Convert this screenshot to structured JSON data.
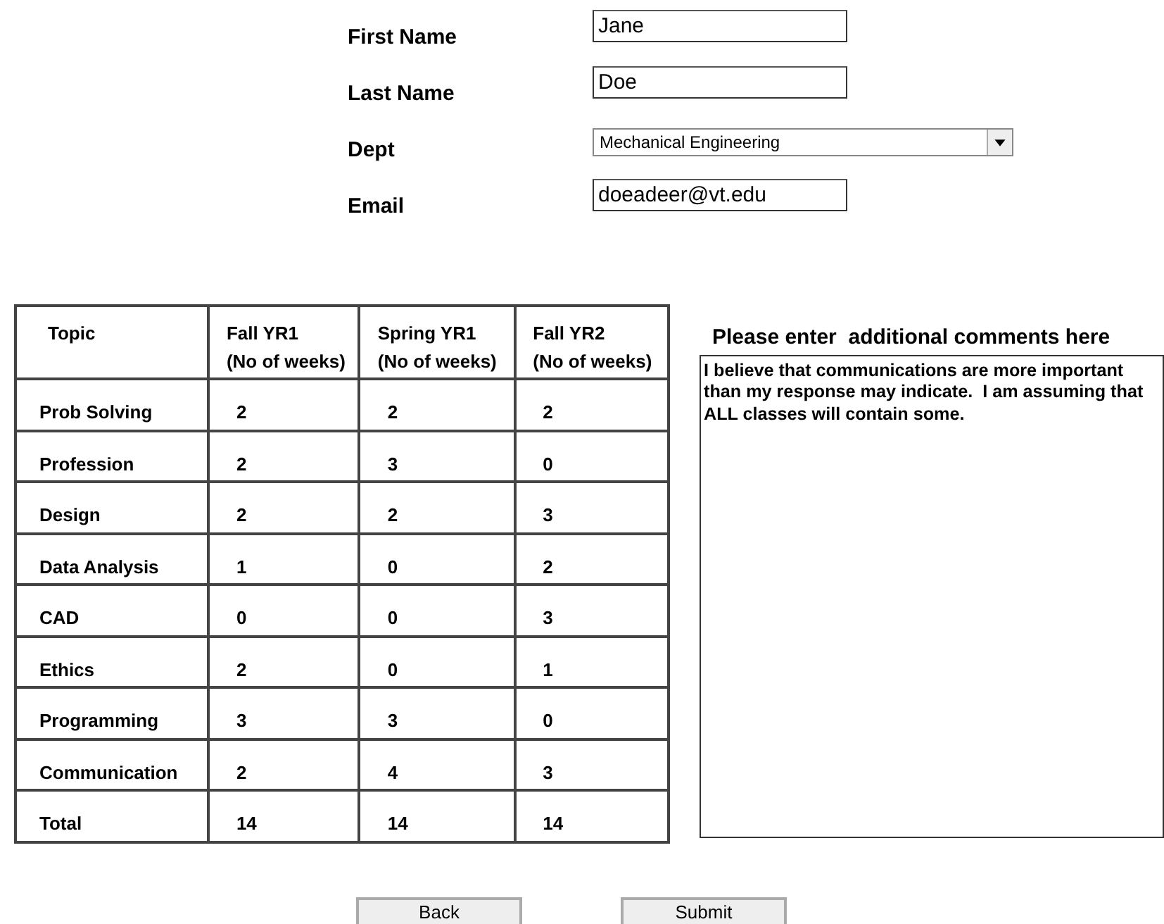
{
  "form": {
    "fields": [
      {
        "label": "First Name",
        "kind": "text",
        "value": "Jane"
      },
      {
        "label": "Last Name",
        "kind": "text",
        "value": "Doe"
      },
      {
        "label": "Dept",
        "kind": "select",
        "value": "Mechanical Engineering"
      },
      {
        "label": "Email",
        "kind": "text",
        "value": "doeadeer@vt.edu"
      }
    ]
  },
  "table": {
    "columns": [
      {
        "title": "Topic"
      },
      {
        "title": "Fall YR1",
        "subtitle": "(No of weeks)"
      },
      {
        "title": "Spring YR1",
        "subtitle": "(No of weeks)"
      },
      {
        "title": "Fall YR2",
        "subtitle": "(No of weeks)"
      }
    ],
    "rows": [
      {
        "topic": "Prob Solving",
        "values": [
          "2",
          "2",
          "2"
        ]
      },
      {
        "topic": "Profession",
        "values": [
          "2",
          "3",
          "0"
        ]
      },
      {
        "topic": "Design",
        "values": [
          "2",
          "2",
          "3"
        ]
      },
      {
        "topic": "Data Analysis",
        "values": [
          "1",
          "0",
          "2"
        ]
      },
      {
        "topic": "CAD",
        "values": [
          "0",
          "0",
          "3"
        ]
      },
      {
        "topic": "Ethics",
        "values": [
          "2",
          "0",
          "1"
        ]
      },
      {
        "topic": "Programming",
        "values": [
          "3",
          "3",
          "0"
        ]
      },
      {
        "topic": "Communication",
        "values": [
          "2",
          "4",
          "3"
        ]
      },
      {
        "topic": "Total",
        "values": [
          "14",
          "14",
          "14"
        ]
      }
    ]
  },
  "comments": {
    "title": "Please enter  additional comments here",
    "text": "I believe that communications are more important than my response may indicate.  I am assuming that ALL classes will contain some."
  },
  "buttons": [
    "Back",
    "Submit"
  ]
}
